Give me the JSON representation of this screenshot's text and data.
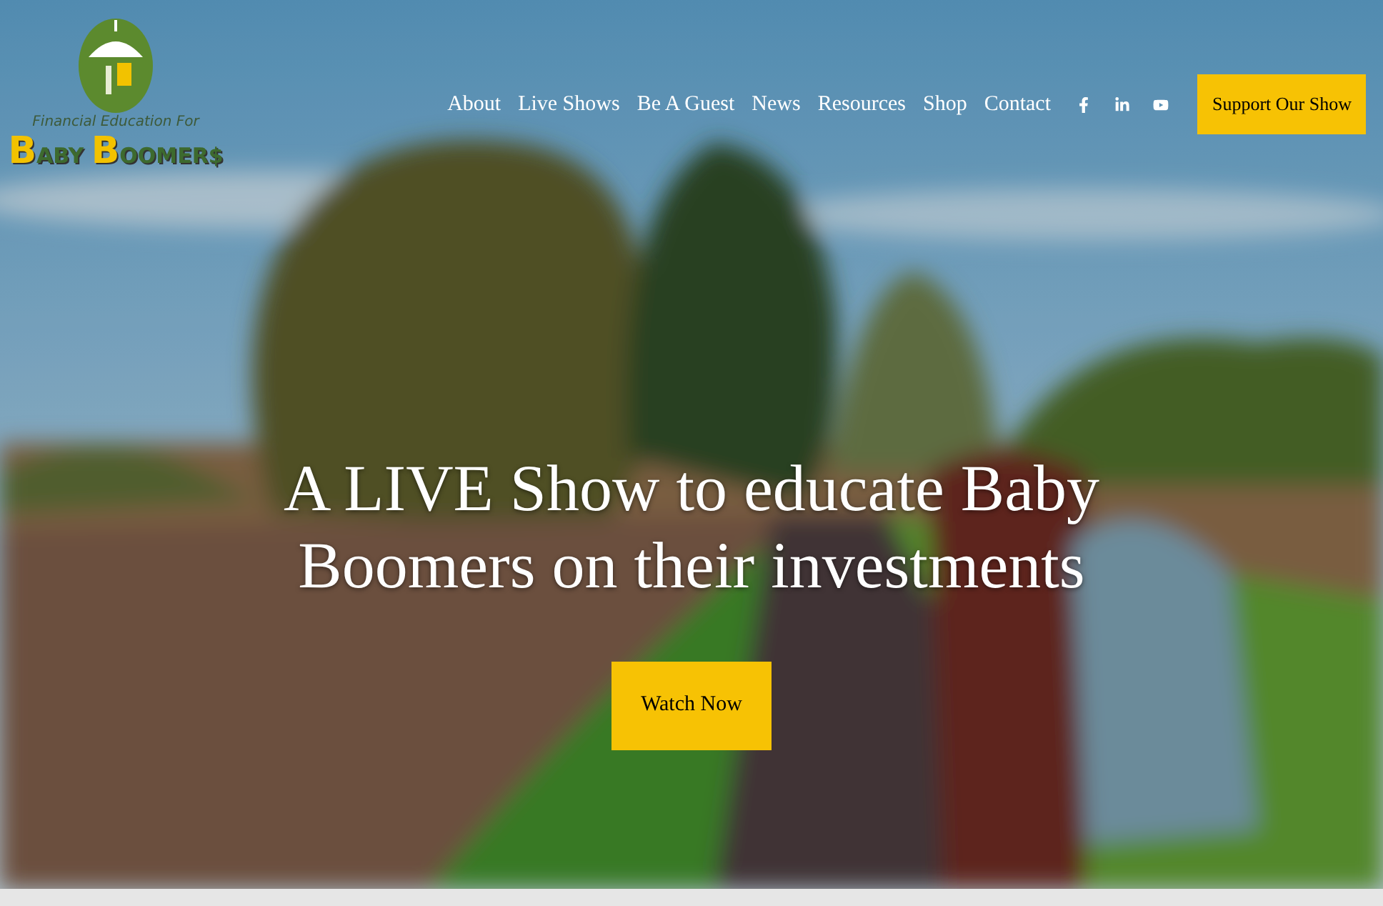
{
  "logo": {
    "tagline": "Financial Education For",
    "name_first": "B",
    "name_first_rest": "ABY ",
    "name_second": "B",
    "name_second_rest": "OOMER$"
  },
  "nav": {
    "links": [
      "About",
      "Live Shows",
      "Be A Guest",
      "News",
      "Resources",
      "Shop",
      "Contact"
    ],
    "social": [
      {
        "kind": "facebook"
      },
      {
        "kind": "linkedin"
      },
      {
        "kind": "youtube"
      }
    ],
    "cta": "Support Our Show"
  },
  "hero": {
    "headline": "A LIVE Show to educate Baby Boomers on their investments",
    "button": "Watch Now"
  }
}
